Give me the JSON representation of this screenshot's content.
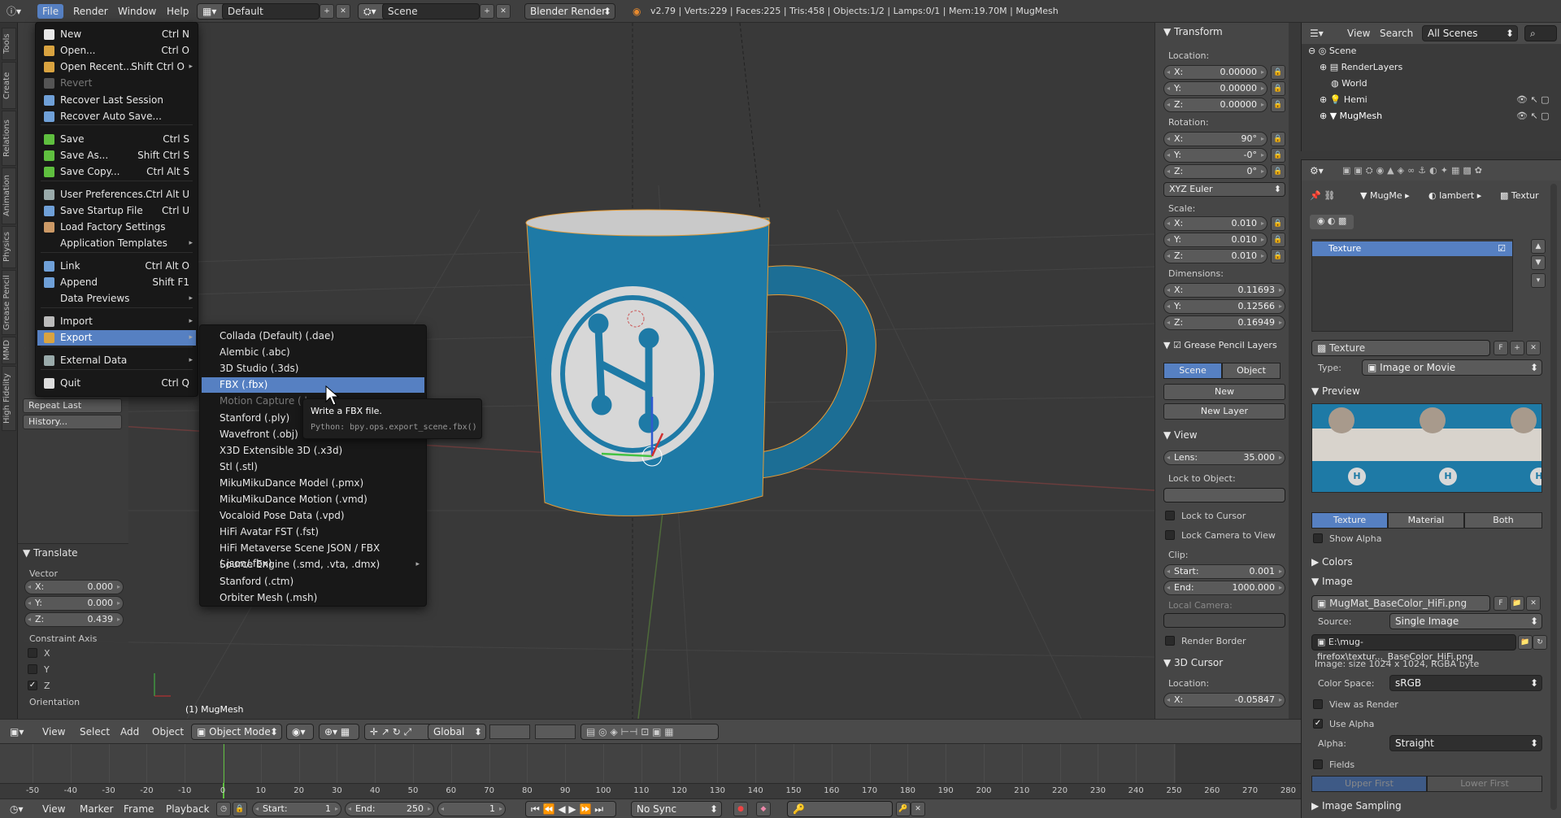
{
  "top": {
    "menus": [
      "File",
      "Render",
      "Window",
      "Help"
    ],
    "layout": "Default",
    "scene": "Scene",
    "engine": "Blender Render",
    "stats": "v2.79 | Verts:229 | Faces:225 | Tris:458 | Objects:1/2 | Lamps:0/1 | Mem:19.70M | MugMesh"
  },
  "file_menu": [
    {
      "label": "New",
      "key": "Ctrl N"
    },
    {
      "label": "Open...",
      "key": "Ctrl O"
    },
    {
      "label": "Open Recent...",
      "key": "Shift Ctrl O"
    },
    {
      "label": "Revert",
      "key": ""
    },
    {
      "label": "Recover Last Session",
      "key": ""
    },
    {
      "label": "Recover Auto Save...",
      "key": ""
    },
    {
      "label": "Save",
      "key": "Ctrl S"
    },
    {
      "label": "Save As...",
      "key": "Shift Ctrl S"
    },
    {
      "label": "Save Copy...",
      "key": "Ctrl Alt S"
    },
    {
      "label": "User Preferences...",
      "key": "Ctrl Alt U"
    },
    {
      "label": "Save Startup File",
      "key": "Ctrl U"
    },
    {
      "label": "Load Factory Settings",
      "key": ""
    },
    {
      "label": "Application Templates",
      "key": ""
    },
    {
      "label": "Link",
      "key": "Ctrl Alt O"
    },
    {
      "label": "Append",
      "key": "Shift F1"
    },
    {
      "label": "Data Previews",
      "key": ""
    },
    {
      "label": "Import",
      "key": ""
    },
    {
      "label": "Export",
      "key": ""
    },
    {
      "label": "External Data",
      "key": ""
    },
    {
      "label": "Quit",
      "key": "Ctrl Q"
    }
  ],
  "export_menu": [
    "Collada (Default) (.dae)",
    "Alembic (.abc)",
    "3D Studio (.3ds)",
    "FBX (.fbx)",
    "Motion Capture (.b",
    "Stanford (.ply)",
    "Wavefront (.obj)",
    "X3D Extensible 3D (.x3d)",
    "Stl (.stl)",
    "MikuMikuDance Model (.pmx)",
    "MikuMikuDance Motion (.vmd)",
    "Vocaloid Pose Data (.vpd)",
    "HiFi Avatar FST (.fst)",
    "HiFi Metaverse Scene JSON / FBX (.json/.fbx)",
    "Source Engine (.smd, .vta, .dmx)",
    "Stanford (.ctm)",
    "Orbiter Mesh (.msh)"
  ],
  "tooltip": {
    "title": "Write a FBX file.",
    "python": "Python: bpy.ops.export_scene.fbx()"
  },
  "left_tabs": [
    "Tools",
    "Create",
    "Relations",
    "Animation",
    "Physics",
    "Grease Pencil",
    "MMD",
    "High Fidelity"
  ],
  "toolshelf": {
    "repeat_last": "Repeat Last",
    "history": "History...",
    "translate": "Translate",
    "vector": "Vector",
    "x": "X:",
    "xv": "0.000",
    "y": "Y:",
    "yv": "0.000",
    "z": "Z:",
    "zv": "0.439",
    "constraint": "Constraint Axis",
    "cx": "X",
    "cy": "Y",
    "cz": "Z",
    "orientation": "Orientation"
  },
  "viewport": {
    "object_label": "(1) MugMesh"
  },
  "nprops": {
    "transform": "Transform",
    "location": "Location:",
    "lx": "0.00000",
    "ly": "0.00000",
    "lz": "0.00000",
    "rotation": "Rotation:",
    "rx": "90°",
    "ry": "-0°",
    "rz": "0°",
    "euler": "XYZ Euler",
    "scale": "Scale:",
    "sx": "0.010",
    "sy": "0.010",
    "sz": "0.010",
    "dimensions": "Dimensions:",
    "dx": "0.11693",
    "dy": "0.12566",
    "dz": "0.16949",
    "grease": "Grease Pencil Layers",
    "scene": "Scene",
    "object": "Object",
    "new": "New",
    "new_layer": "New Layer",
    "view": "View",
    "lens": "Lens:",
    "lens_v": "35.000",
    "lock_obj": "Lock to Object:",
    "lock_cursor": "Lock to Cursor",
    "lock_cam": "Lock Camera to View",
    "clip": "Clip:",
    "start": "Start:",
    "start_v": "0.001",
    "end": "End:",
    "end_v": "1000.000",
    "local_cam": "Local Camera:",
    "render_border": "Render Border",
    "cursor": "3D Cursor",
    "cloc": "Location:",
    "cx": "-0.05847"
  },
  "outliner": {
    "menus": [
      "View",
      "Search"
    ],
    "filter": "All Scenes",
    "items": [
      "Scene",
      "RenderLayers",
      "World",
      "Hemi",
      "MugMesh"
    ]
  },
  "props": {
    "crumbs": [
      "MugMe",
      "lambert",
      "Textur"
    ],
    "slot": "Texture",
    "tex_name": "Texture",
    "type": "Type:",
    "type_v": "Image or Movie",
    "preview": "Preview",
    "t_texture": "Texture",
    "t_material": "Material",
    "t_both": "Both",
    "show_alpha": "Show Alpha",
    "colors": "Colors",
    "image": "Image",
    "img_name": "MugMat_BaseColor_HiFi.png",
    "source": "Source:",
    "source_v": "Single Image",
    "path": "E:\\mug-firefox\\textur..._BaseColor_HiFi.png",
    "info": "Image: size 1024 x 1024, RGBA byte",
    "colorspace": "Color Space:",
    "colorspace_v": "sRGB",
    "view_render": "View as Render",
    "use_alpha": "Use Alpha",
    "alpha": "Alpha:",
    "alpha_v": "Straight",
    "fields": "Fields",
    "upper": "Upper First",
    "lower": "Lower First",
    "sampling": "Image Sampling"
  },
  "vpheader": {
    "view": "View",
    "select": "Select",
    "add": "Add",
    "object": "Object",
    "mode": "Object Mode",
    "orient": "Global"
  },
  "timeline": {
    "ticks": [
      "-50",
      "-40",
      "-30",
      "-20",
      "-10",
      "0",
      "10",
      "20",
      "30",
      "40",
      "50",
      "60",
      "70",
      "80",
      "90",
      "100",
      "110",
      "120",
      "130",
      "140",
      "150",
      "160",
      "170",
      "180",
      "190",
      "200",
      "210",
      "220",
      "230",
      "240",
      "250",
      "260",
      "270",
      "280"
    ],
    "view": "View",
    "marker": "Marker",
    "frame": "Frame",
    "playback": "Playback",
    "start": "Start:",
    "start_v": "1",
    "end": "End:",
    "end_v": "250",
    "cur": "1",
    "sync": "No Sync"
  }
}
